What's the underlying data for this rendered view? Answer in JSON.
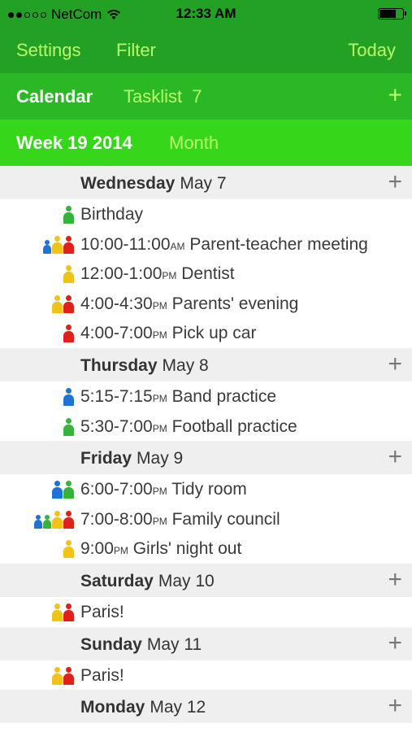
{
  "status": {
    "carrier": "NetCom",
    "time": "12:33 AM",
    "battery_level": 0.75
  },
  "nav": {
    "settings": "Settings",
    "filter": "Filter",
    "today": "Today"
  },
  "tabs": {
    "calendar": "Calendar",
    "tasklist": "Tasklist",
    "tasklist_count": "7",
    "add": "+"
  },
  "views": {
    "week": "Week 19 2014",
    "month": "Month"
  },
  "colors": {
    "red": "#e0201a",
    "yellow": "#f0c21a",
    "green": "#35b33a",
    "blue": "#1f73d6"
  },
  "days": [
    {
      "name": "Wednesday",
      "date": "May 7",
      "add": "+",
      "events": [
        {
          "time": "",
          "ampm": "",
          "title": "Birthday",
          "people": [
            "green"
          ]
        },
        {
          "time": "10:00-11:00",
          "ampm": "AM",
          "title": " Parent-teacher meeting",
          "people": [
            "blue",
            "yellow",
            "red"
          ]
        },
        {
          "time": "12:00-1:00",
          "ampm": "PM",
          "title": " Dentist",
          "people": [
            "yellow"
          ]
        },
        {
          "time": "4:00-4:30",
          "ampm": "PM",
          "title": " Parents' evening",
          "people": [
            "yellow",
            "red"
          ]
        },
        {
          "time": "4:00-7:00",
          "ampm": "PM",
          "title": " Pick up car",
          "people": [
            "red"
          ]
        }
      ]
    },
    {
      "name": "Thursday",
      "date": "May 8",
      "add": "+",
      "events": [
        {
          "time": "5:15-7:15",
          "ampm": "PM",
          "title": " Band practice",
          "people": [
            "blue"
          ]
        },
        {
          "time": "5:30-7:00",
          "ampm": "PM",
          "title": " Football practice",
          "people": [
            "green"
          ]
        }
      ]
    },
    {
      "name": "Friday",
      "date": "May 9",
      "add": "+",
      "events": [
        {
          "time": "6:00-7:00",
          "ampm": "PM",
          "title": " Tidy room",
          "people": [
            "blue",
            "green"
          ]
        },
        {
          "time": "7:00-8:00",
          "ampm": "PM",
          "title": " Family council",
          "people": [
            "blue",
            "green",
            "yellow",
            "red"
          ]
        },
        {
          "time": "9:00",
          "ampm": "PM",
          "title": " Girls' night out",
          "people": [
            "yellow"
          ]
        }
      ]
    },
    {
      "name": "Saturday",
      "date": "May 10",
      "add": "+",
      "events": [
        {
          "time": "",
          "ampm": "",
          "title": "Paris!",
          "people": [
            "yellow",
            "red"
          ]
        }
      ]
    },
    {
      "name": "Sunday",
      "date": "May 11",
      "add": "+",
      "events": [
        {
          "time": "",
          "ampm": "",
          "title": "Paris!",
          "people": [
            "yellow",
            "red"
          ]
        }
      ]
    },
    {
      "name": "Monday",
      "date": "May 12",
      "add": "+",
      "events": []
    }
  ]
}
